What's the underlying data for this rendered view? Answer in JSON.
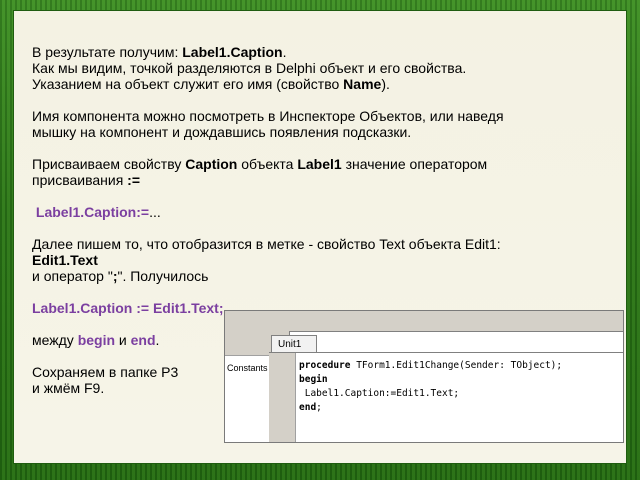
{
  "slide": {
    "p1": {
      "line1_prefix": "В результате получим: ",
      "line1_bold": "Label1.Caption",
      "line1_suffix": ".",
      "line2": "Как мы видим, точкой разделяются в Delphi объект и его свойства.",
      "line3_prefix": "Указанием на объект служит его имя (свойство ",
      "line3_bold": "Name",
      "line3_suffix": ")."
    },
    "p2": {
      "line1": "Имя компонента можно посмотреть в Инспекторе Объектов, или наведя",
      "line2": "мышку на компонент и дождавшись появления подсказки."
    },
    "p3": {
      "line1_a": "Присваиваем свойству ",
      "line1_b": "Caption",
      "line1_c": " объекта ",
      "line1_d": "Label1",
      "line1_e": " значение оператором",
      "line2_a": "присваивания ",
      "line2_b": ":="
    },
    "p4": {
      "code": "Label1.Caption:=",
      "dots": "..."
    },
    "p5": {
      "line1": "Далее пишем то, что отобразится в метке - свойство Text объекта Edit1:",
      "line2_bold": "Edit1.Text",
      "line3_a": "и оператор \"",
      "line3_b": ";",
      "line3_c": "\".    Получилось"
    },
    "p6": {
      "code": "Label1.Caption := Edit1.Text;"
    },
    "p7": {
      "a": "между ",
      "b": "begin",
      "c": " и ",
      "d": "end",
      "e": "."
    },
    "p8": {
      "line1": "Сохраняем в папке Р3",
      "line2": "и жмём F9."
    }
  },
  "editor": {
    "tab_label": "Unit1",
    "left_pane_label": "Constants",
    "code_lines": [
      {
        "kw": "procedure",
        "rest": " TForm1.Edit1Change(Sender: TObject);"
      },
      {
        "kw": "begin",
        "rest": ""
      },
      {
        "kw": "",
        "rest": " Label1.Caption:=Edit1.Text;"
      },
      {
        "kw": "end",
        "rest": ";"
      }
    ]
  }
}
